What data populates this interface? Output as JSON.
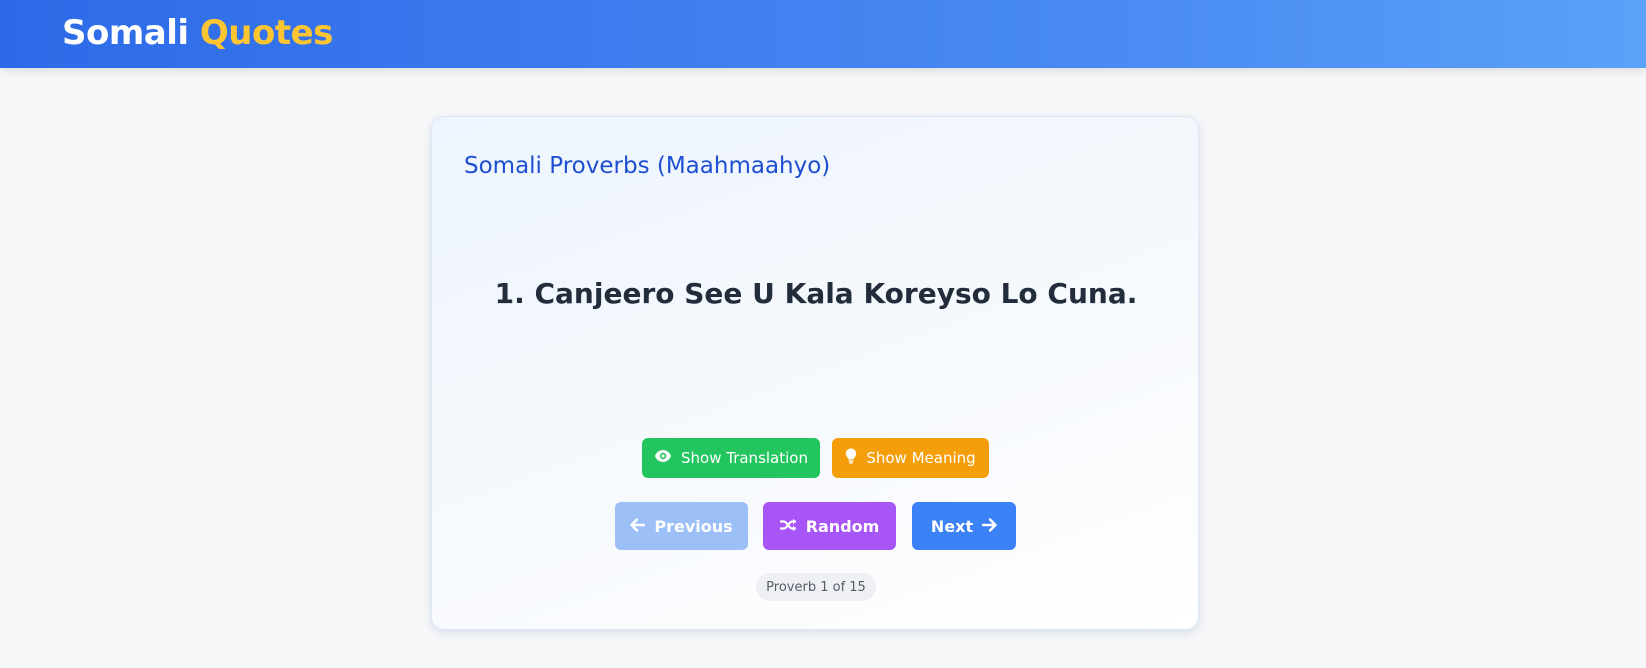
{
  "header": {
    "logo_main": "Somali",
    "logo_accent": "Quotes",
    "background_gradient": [
      "#2d6ae8",
      "#5aa2f8"
    ],
    "accent_color": "#fcc531"
  },
  "card": {
    "title": "Somali Proverbs (Maahmaahyo)",
    "proverb_text": "1. Canjeero See U Kala Koreyso Lo Cuna.",
    "buttons": {
      "show_translation": {
        "label": "Show Translation",
        "icon": "eye-icon",
        "color": "#22c55e"
      },
      "show_meaning": {
        "label": "Show Meaning",
        "icon": "lightbulb-icon",
        "color": "#f59e0b"
      },
      "previous": {
        "label": "Previous",
        "icon": "arrow-left-icon",
        "color": "#9dbff8",
        "state": "disabled"
      },
      "random": {
        "label": "Random",
        "icon": "shuffle-icon",
        "color": "#a855f7"
      },
      "next": {
        "label": "Next",
        "icon": "arrow-right-icon",
        "color": "#3b82f6"
      }
    },
    "counter": "Proverb 1 of 15"
  }
}
